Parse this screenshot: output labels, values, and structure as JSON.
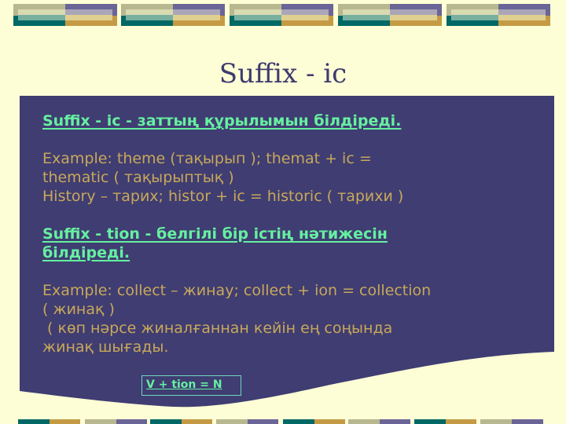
{
  "slide": {
    "title": "Suffix - ic",
    "sections": [
      {
        "heading": "Suffix - ic - заттың құрылымын білдіреді.",
        "lines": [
          "Example: theme (тақырып ); themat + ic =",
          "thematic ( тақырыптық )",
          "History – тарих; histor + ic = historic ( тарихи )"
        ]
      },
      {
        "heading_lines": [
          "Suffix - tion - белгілі бір істің нәтижесін",
          "білдіреді."
        ],
        "lines": [
          "Example: collect – жинау; collect + ion = collection",
          "( жинақ )",
          " ( көп нәрсе жиналғаннан кейін ең соңында",
          "жинақ шығады."
        ]
      }
    ],
    "formula_box": "V + tion = N"
  },
  "theme": {
    "background": "#fdfdd6",
    "panel": "#3f3d72",
    "heading_color": "#66f0a0",
    "body_color": "#c8a85a",
    "title_color": "#3e3b6e"
  }
}
